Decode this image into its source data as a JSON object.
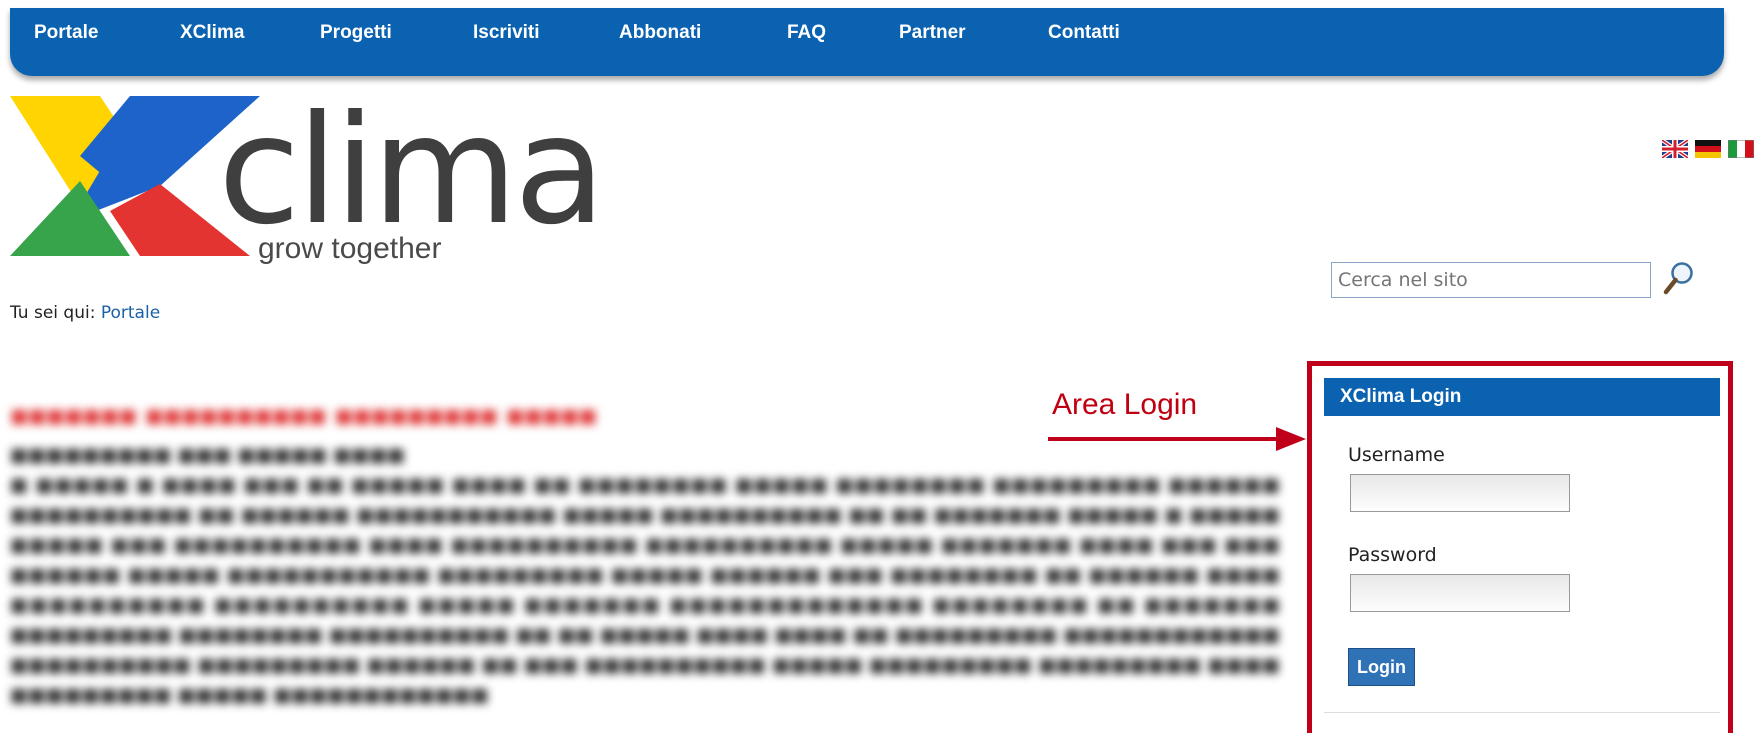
{
  "nav": {
    "items": [
      "Portale",
      "XClima",
      "Progetti",
      "Iscriviti",
      "Abbonati",
      "FAQ",
      "Partner",
      "Contatti"
    ]
  },
  "brand": {
    "word": "clima",
    "tagline": "grow together",
    "colors": {
      "yellow": "#ffd400",
      "blue": "#1d63c9",
      "green": "#37a34a",
      "red": "#e43431",
      "wordmark": "#3f3f3f"
    }
  },
  "flags": [
    "flag-uk-icon",
    "flag-germany-icon",
    "flag-italy-icon"
  ],
  "search": {
    "placeholder": "Cerca nel sito"
  },
  "breadcrumb": {
    "prefix": "Tu sei qui:",
    "current": "Portale"
  },
  "annotation": {
    "label": "Area Login",
    "color": "#c0001a"
  },
  "login": {
    "title": "XClima Login",
    "username_label": "Username",
    "password_label": "Password",
    "button_label": "Login"
  }
}
